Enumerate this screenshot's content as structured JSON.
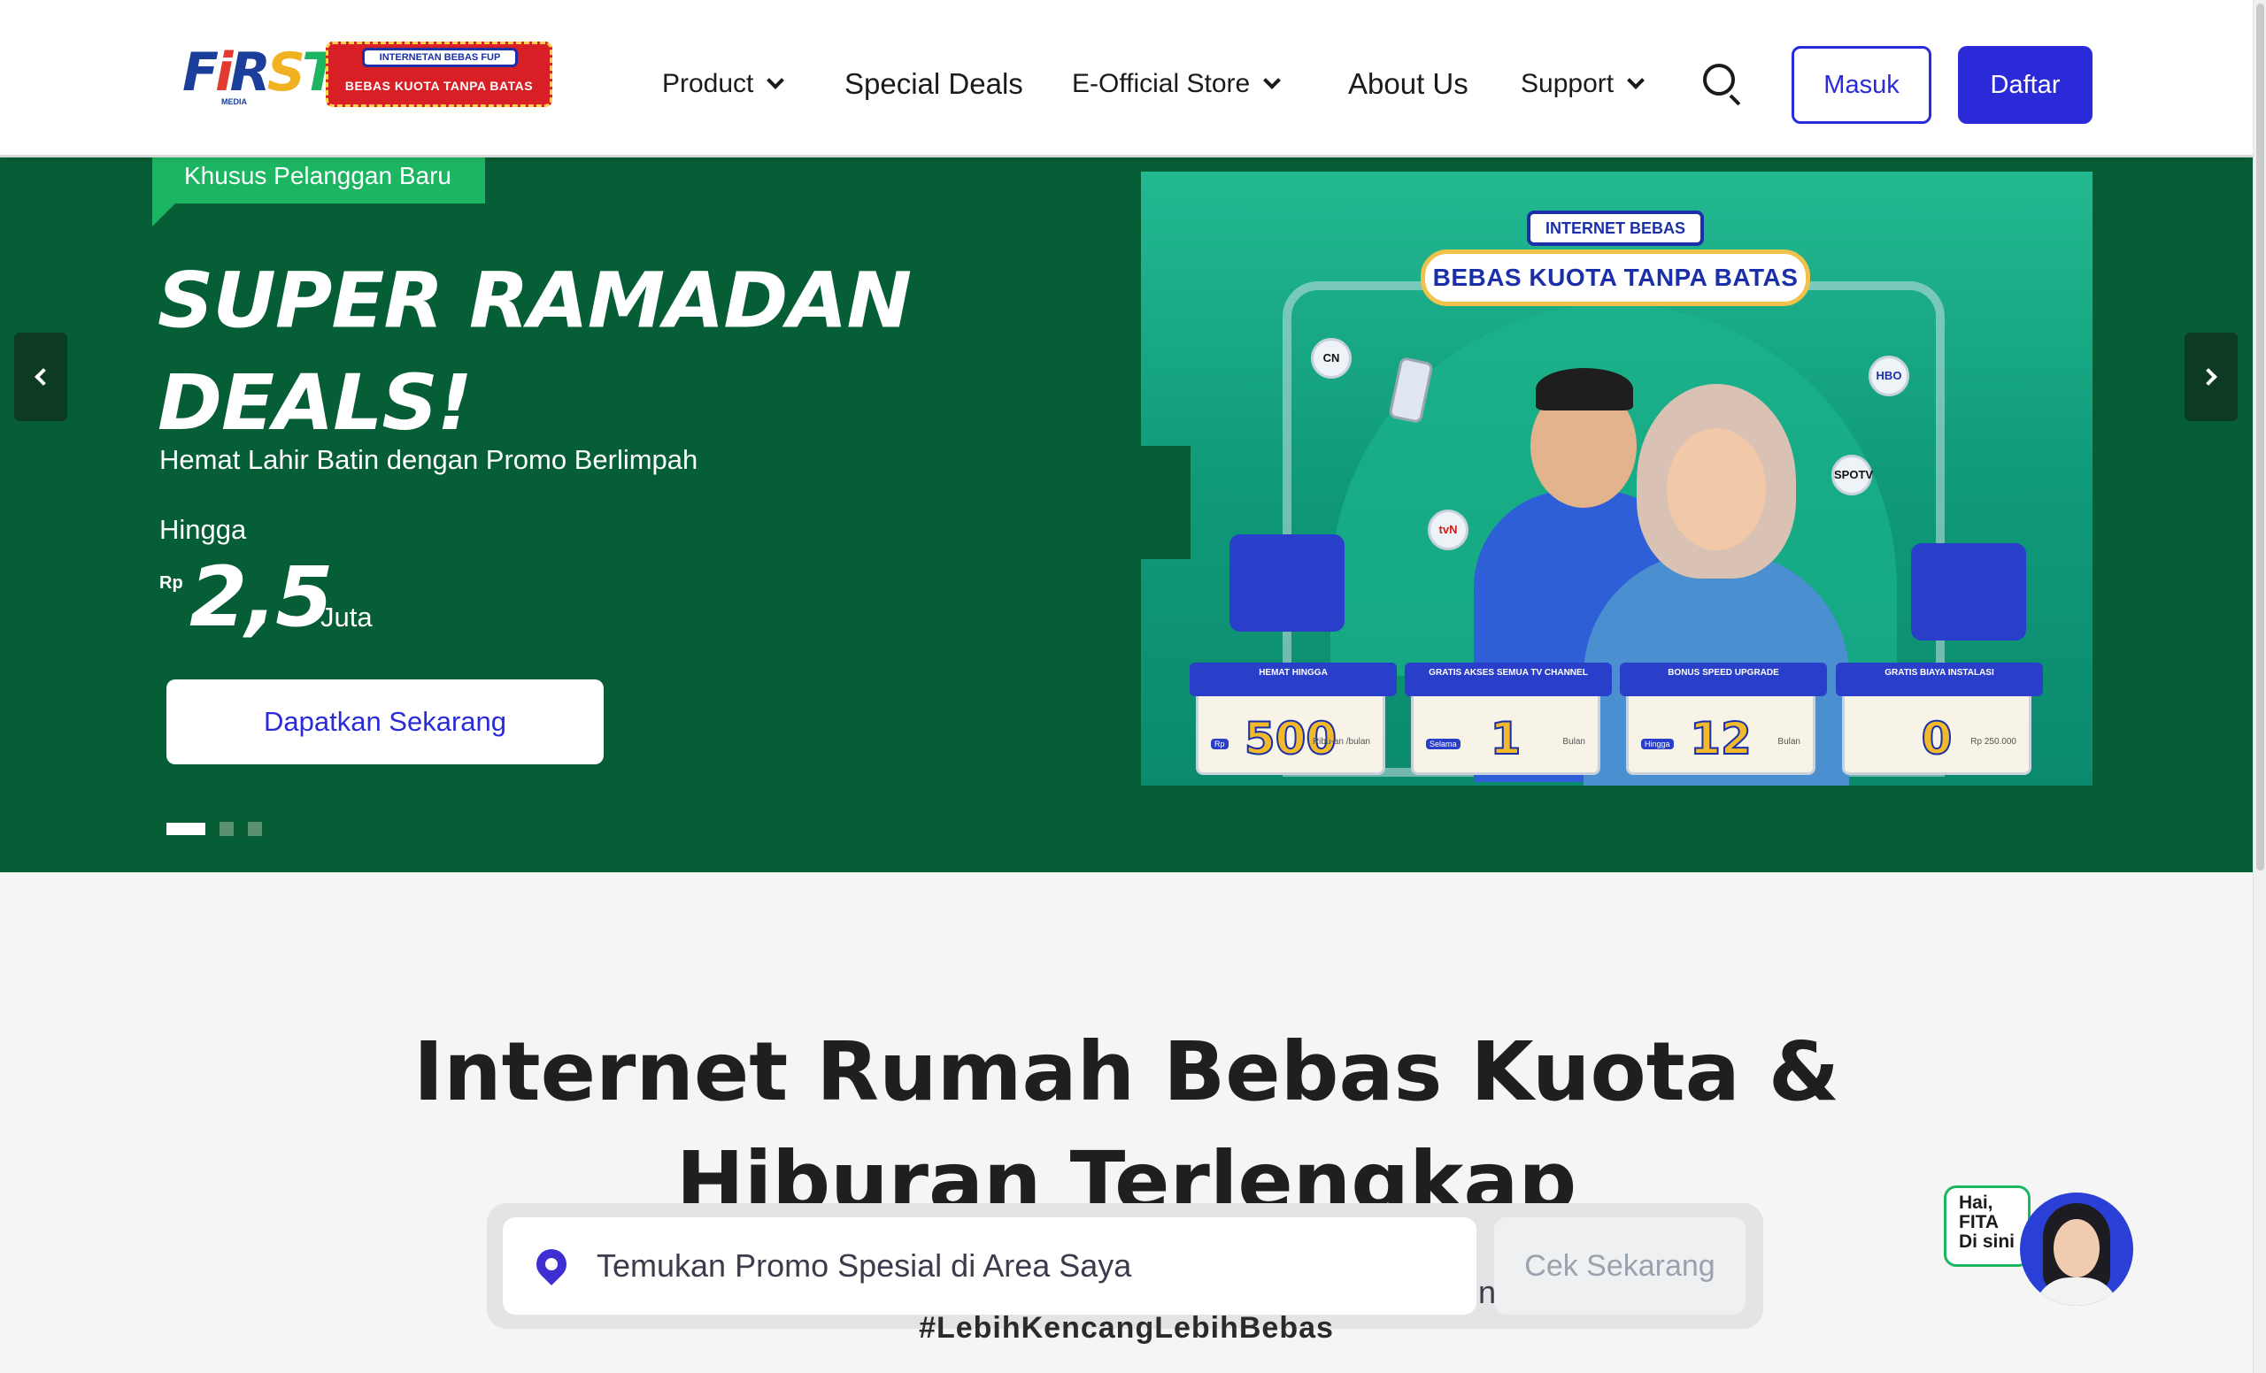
{
  "header": {
    "logo_text": "FiRST",
    "logo_sub": "MEDIA",
    "badge_top": "INTERNETAN BEBAS FUP",
    "badge_bottom": "BEBAS KUOTA TANPA BATAS",
    "nav": {
      "product": "Product",
      "special_deals": "Special Deals",
      "store": "E-Official Store",
      "about": "About Us",
      "support": "Support"
    },
    "masuk": "Masuk",
    "daftar": "Daftar"
  },
  "hero": {
    "tag": "Khusus Pelanggan Baru",
    "title_line1": "SUPER RAMADAN",
    "title_line2": "DEALS!",
    "subtitle": "Hemat Lahir Batin dengan Promo Berlimpah",
    "hingga": "Hingga",
    "rp": "Rp",
    "amount": "2,5",
    "unit": "Juta",
    "cta": "Dapatkan Sekarang",
    "slide_count": 3,
    "active_slide": 1
  },
  "banner": {
    "sign_small": "INTERNET BEBAS FUP",
    "sign_big": "BEBAS KUOTA TANPA BATAS",
    "channels": [
      "CN",
      "HBO",
      "SPOTV",
      "tvN"
    ],
    "cards": [
      {
        "header": "HEMAT HINGGA",
        "prefix": "Rp",
        "value": "500",
        "unit": "Ribu-an /bulan"
      },
      {
        "header": "GRATIS AKSES SEMUA TV CHANNEL",
        "prefix": "Selama",
        "value": "1",
        "unit": "Bulan"
      },
      {
        "header": "BONUS SPEED UPGRADE",
        "prefix": "Hingga",
        "value": "12",
        "unit": "Bulan"
      },
      {
        "header": "GRATIS BIAYA INSTALASI",
        "prefix": "",
        "value": "0",
        "unit": "Rp 250.000"
      }
    ]
  },
  "main": {
    "title_line1": "Internet Rumah Bebas Kuota &",
    "title_line2": "Hiburan Terlengkap",
    "hashtag": "#LebihKencangLebihBebas",
    "search_placeholder": "Temukan Promo Spesial di Area Saya",
    "search_ghost": "n",
    "check_button": "Cek Sekarang"
  },
  "chat": {
    "line1": "Hai,",
    "line2": "FITA",
    "line3": "Di sini"
  },
  "colors": {
    "brand_blue": "#2a2ad9",
    "hero_green": "#065e36",
    "tag_green": "#1cb561"
  }
}
